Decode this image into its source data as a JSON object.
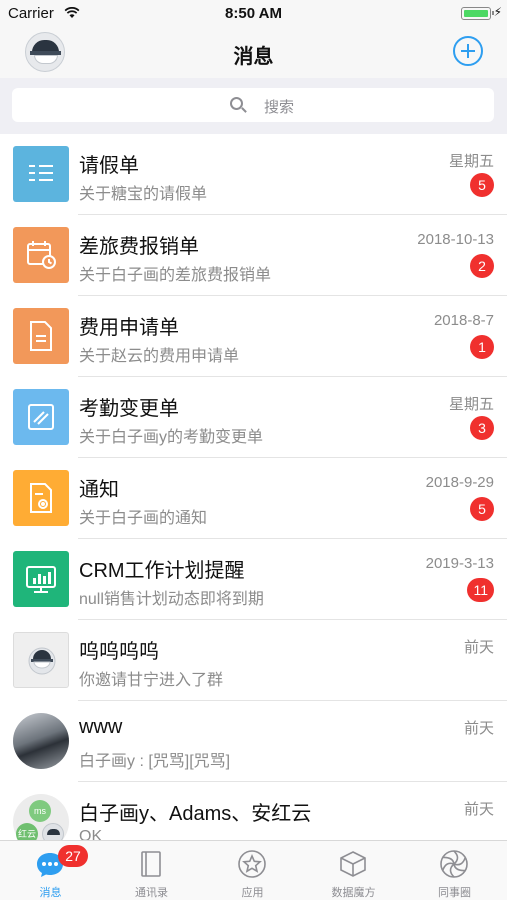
{
  "status_bar": {
    "carrier": "Carrier",
    "time": "8:50 AM"
  },
  "nav": {
    "title": "消息"
  },
  "search": {
    "placeholder": "搜索"
  },
  "messages": [
    {
      "title": "请假单",
      "subtitle": "关于糖宝的请假单",
      "date": "星期五",
      "badge": "5",
      "icon": "leave-form-icon"
    },
    {
      "title": "差旅费报销单",
      "subtitle": "关于白子画的差旅费报销单",
      "date": "2018-10-13",
      "badge": "2",
      "icon": "travel-expense-icon"
    },
    {
      "title": "费用申请单",
      "subtitle": "关于赵云的费用申请单",
      "date": "2018-8-7",
      "badge": "1",
      "icon": "expense-request-icon"
    },
    {
      "title": "考勤变更单",
      "subtitle": "关于白子画y的考勤变更单",
      "date": "星期五",
      "badge": "3",
      "icon": "attendance-change-icon"
    },
    {
      "title": "通知",
      "subtitle": "关于白子画的通知",
      "date": "2018-9-29",
      "badge": "5",
      "icon": "notice-icon"
    },
    {
      "title": "CRM工作计划提醒",
      "subtitle": "null销售计划动态即将到期",
      "date": "2019-3-13",
      "badge": "11",
      "icon": "crm-plan-icon"
    },
    {
      "title": "呜呜呜呜",
      "subtitle": "你邀请甘宁进入了群",
      "date": "前天",
      "badge": "",
      "icon": "group-avatar-icon"
    },
    {
      "title": "www",
      "subtitle": "白子画y : [咒骂][咒骂]",
      "date": "前天",
      "badge": "",
      "icon": "photo-avatar"
    },
    {
      "title": "白子画y、Adams、安红云",
      "subtitle": "OK",
      "date": "前天",
      "badge": "",
      "icon": "group-chat-avatar",
      "avatar_initials": [
        "ms",
        "红云"
      ]
    }
  ],
  "tabbar": {
    "items": [
      {
        "label": "消息",
        "icon": "chat-bubble-icon",
        "active": true,
        "badge": "27"
      },
      {
        "label": "通讯录",
        "icon": "contacts-book-icon",
        "active": false
      },
      {
        "label": "应用",
        "icon": "star-circle-icon",
        "active": false
      },
      {
        "label": "数据魔方",
        "icon": "cube-icon",
        "active": false
      },
      {
        "label": "同事圈",
        "icon": "shutter-icon",
        "active": false
      }
    ]
  },
  "colors": {
    "accent": "#2e9ef0",
    "badge": "#f0302e",
    "icon_blue": "#5cb4de",
    "icon_orange": "#f2985a",
    "icon_lightblue": "#6cb9ee",
    "icon_yellow": "#ffac34",
    "icon_green": "#1fb57a"
  }
}
